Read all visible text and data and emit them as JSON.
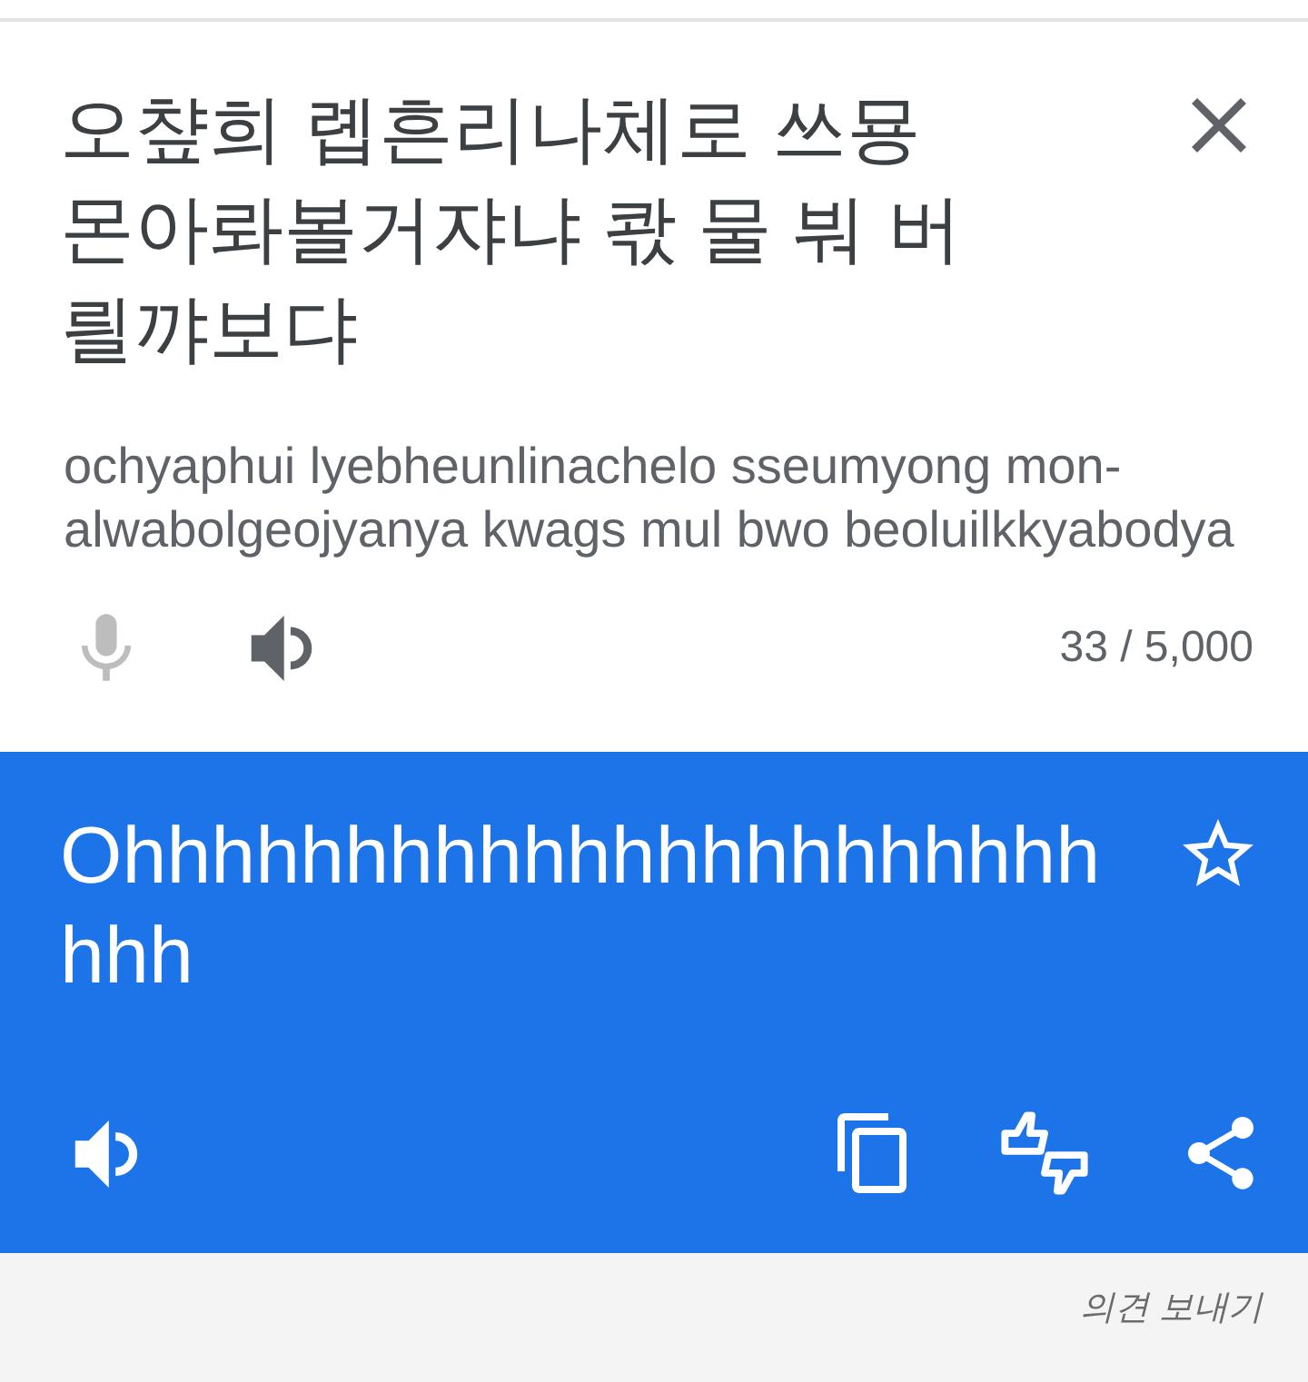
{
  "source": {
    "text": "오챺희 롑흔리나체로 쓰묭 몬아롸볼거쟈냐 콳 물 붜 버릘꺄보댜",
    "romanization": "ochyaphui lyebheunlinachelo sseumyong mon-alwabolgeojyanya kwags mul bwo beoluilkkyabodya",
    "mic": {
      "disabled": true
    },
    "char_count": "33 / 5,000"
  },
  "translation": {
    "text": "Ohhhhhhhhhhhhhhhhhhhhhhhhh",
    "starred": false
  },
  "footer": {
    "feedback_link": "의견 보내기"
  }
}
